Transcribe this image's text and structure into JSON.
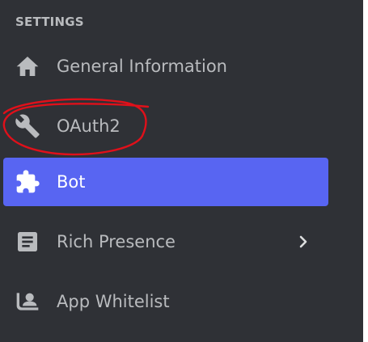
{
  "settings": {
    "header": "SETTINGS",
    "items": [
      {
        "label": "General Information",
        "icon": "home-icon",
        "active": false
      },
      {
        "label": "OAuth2",
        "icon": "wrench-icon",
        "active": false
      },
      {
        "label": "Bot",
        "icon": "puzzle-piece-icon",
        "active": true
      },
      {
        "label": "Rich Presence",
        "icon": "document-icon",
        "active": false,
        "has_submenu": true
      },
      {
        "label": "App Whitelist",
        "icon": "user-whitelist-icon",
        "active": false
      }
    ]
  },
  "colors": {
    "sidebar_bg": "#2f3136",
    "text_muted": "#b9bbbe",
    "active_bg": "#5865f2",
    "active_text": "#ffffff",
    "annotation_stroke": "#e0101a"
  },
  "annotation": {
    "shape": "hand-drawn red circle",
    "target": "OAuth2"
  }
}
